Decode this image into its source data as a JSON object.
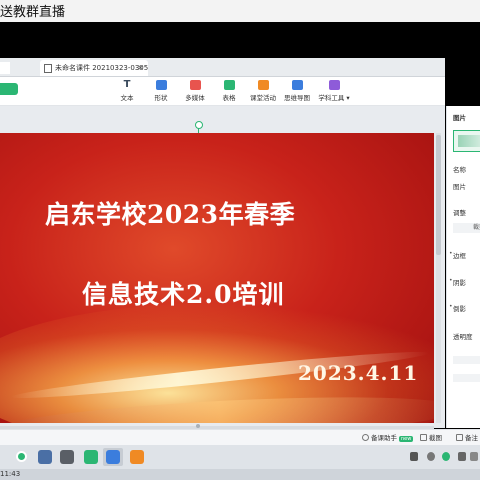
{
  "window": {
    "title": "送教群直播"
  },
  "tabs": [
    {
      "label": "未命名课件 20210323-0305...",
      "close": "×"
    }
  ],
  "toolbar": {
    "tools": [
      {
        "label": "文本",
        "icon": "text-icon",
        "color": "#3a4a5c"
      },
      {
        "label": "形状",
        "icon": "shape-icon",
        "color": "#3b7ddd"
      },
      {
        "label": "多媒体",
        "icon": "media-icon",
        "color": "#e8544e"
      },
      {
        "label": "表格",
        "icon": "table-icon",
        "color": "#2bb673"
      },
      {
        "label": "课堂活动",
        "icon": "activity-icon",
        "color": "#f08a24"
      },
      {
        "label": "思维导图",
        "icon": "mindmap-icon",
        "color": "#3b7ddd"
      },
      {
        "label": "学科工具 ▾",
        "icon": "subject-tools-icon",
        "color": "#8e5bd9"
      }
    ]
  },
  "slide": {
    "title_line1": "启东学校2023年春季",
    "title_line2": "信息技术2.0培训",
    "date": "2023.4.11"
  },
  "right_panel": {
    "section": "图片",
    "name_label": "名称",
    "name_value": "图片",
    "adjust_label": "调整",
    "adjust_button": "裁剪",
    "border_label": "边框",
    "shadow_label": "阴影",
    "reflection_label": "倒影",
    "opacity_label": "透明度"
  },
  "status": {
    "assistant": "备课助手",
    "assistant_badge": "new",
    "screenshot": "截图",
    "notes": "备注"
  },
  "taskbar": {
    "clock_partial": "11:43"
  },
  "colors": {
    "accent": "#2bb673",
    "slide_red": "#c8221a"
  }
}
